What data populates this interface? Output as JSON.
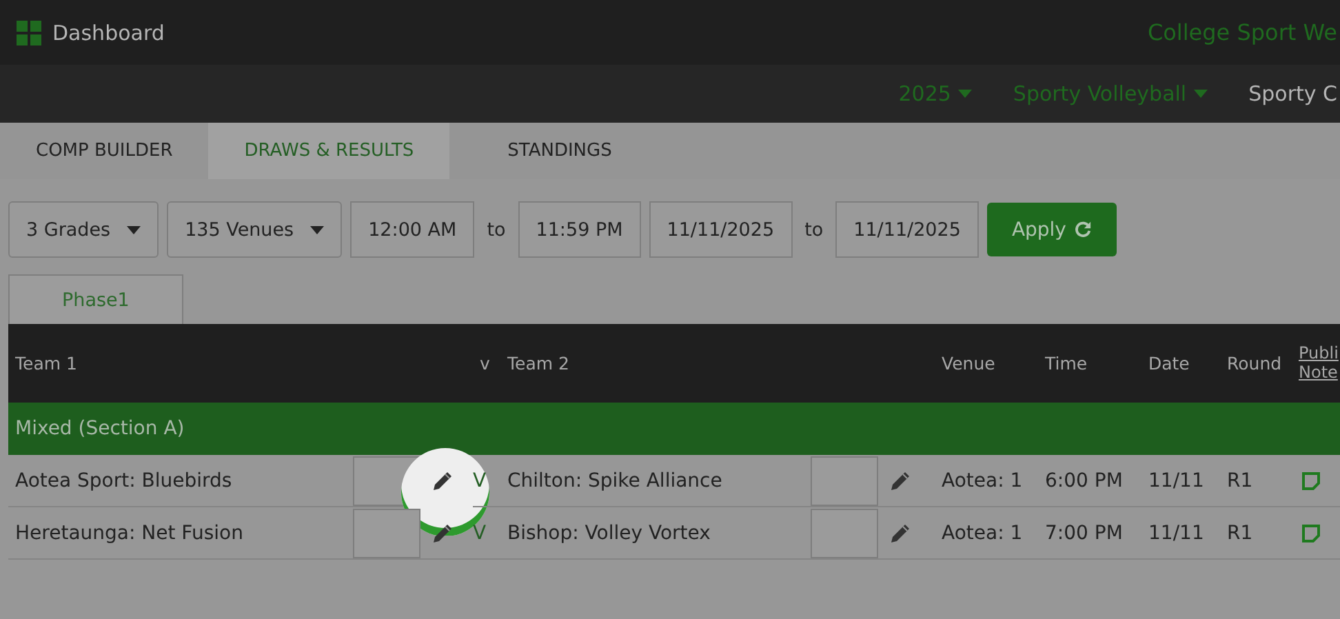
{
  "top_bar": {
    "title": "Dashboard",
    "brand": "College Sport We"
  },
  "context_bar": {
    "selectors": [
      {
        "label": "2025",
        "kind": "dropdown"
      },
      {
        "label": "Sporty Volleyball",
        "kind": "dropdown"
      },
      {
        "label": "Sporty C",
        "kind": "plain"
      }
    ]
  },
  "tabs": [
    {
      "label": "COMP BUILDER",
      "selected": false
    },
    {
      "label": "DRAWS & RESULTS",
      "selected": true
    },
    {
      "label": "STANDINGS",
      "selected": false
    }
  ],
  "filters": {
    "grades": "3 Grades",
    "venues": "135 Venues",
    "time_from": "12:00 AM",
    "time_sep": "to",
    "time_to": "11:59 PM",
    "date_from": "11/11/2025",
    "date_sep": "to",
    "date_to": "11/11/2025",
    "apply": "Apply"
  },
  "phase_tabs": [
    {
      "label": "Phase1",
      "selected": true
    }
  ],
  "table": {
    "columns": [
      "Team 1",
      "v",
      "Team 2",
      "Venue",
      "Time",
      "Date",
      "Round",
      "Publi Note"
    ],
    "groups": [
      {
        "title": "Mixed (Section A)",
        "rows": [
          {
            "team1": "Aotea Sport: Bluebirds",
            "vs": "V",
            "team2": "Chilton: Spike Alliance",
            "venue": "Aotea: 1",
            "time": "6:00 PM",
            "date": "11/11",
            "round": "R1",
            "spotlight": true
          },
          {
            "team1": "Heretaunga: Net Fusion",
            "vs": "V",
            "team2": "Bishop: Volley Vortex",
            "venue": "Aotea: 1",
            "time": "7:00 PM",
            "date": "11/11",
            "round": "R1",
            "spotlight": false
          }
        ]
      }
    ]
  }
}
